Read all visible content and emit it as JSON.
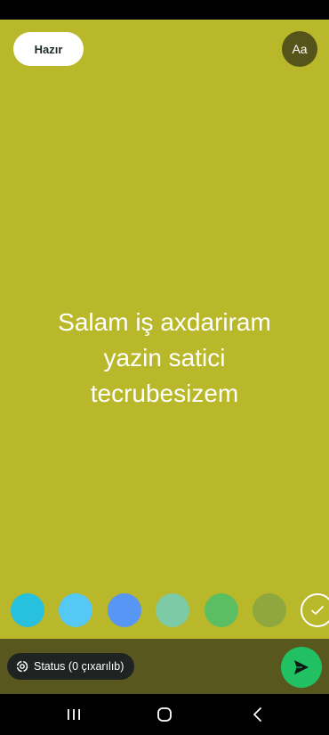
{
  "header": {
    "done_label": "Hazır",
    "font_label": "Aa"
  },
  "status": {
    "lines": [
      "Salam iş axdariram",
      "yazin satici",
      "tecrubesizem"
    ]
  },
  "palette": {
    "colors": [
      "#27c0de",
      "#56c8f5",
      "#5896f5",
      "#7dcba6",
      "#5bbe63",
      "#8ea83f"
    ],
    "background": "#b9b72a"
  },
  "footer": {
    "audience_label": "Status (0 çıxarılıb)",
    "send_color": "#21c063"
  },
  "icons": {
    "audience": "status-ring-icon",
    "send": "send-arrow-icon",
    "check": "check-icon",
    "nav_recent": "recent-apps-icon",
    "nav_home": "home-icon",
    "nav_back": "back-icon"
  }
}
